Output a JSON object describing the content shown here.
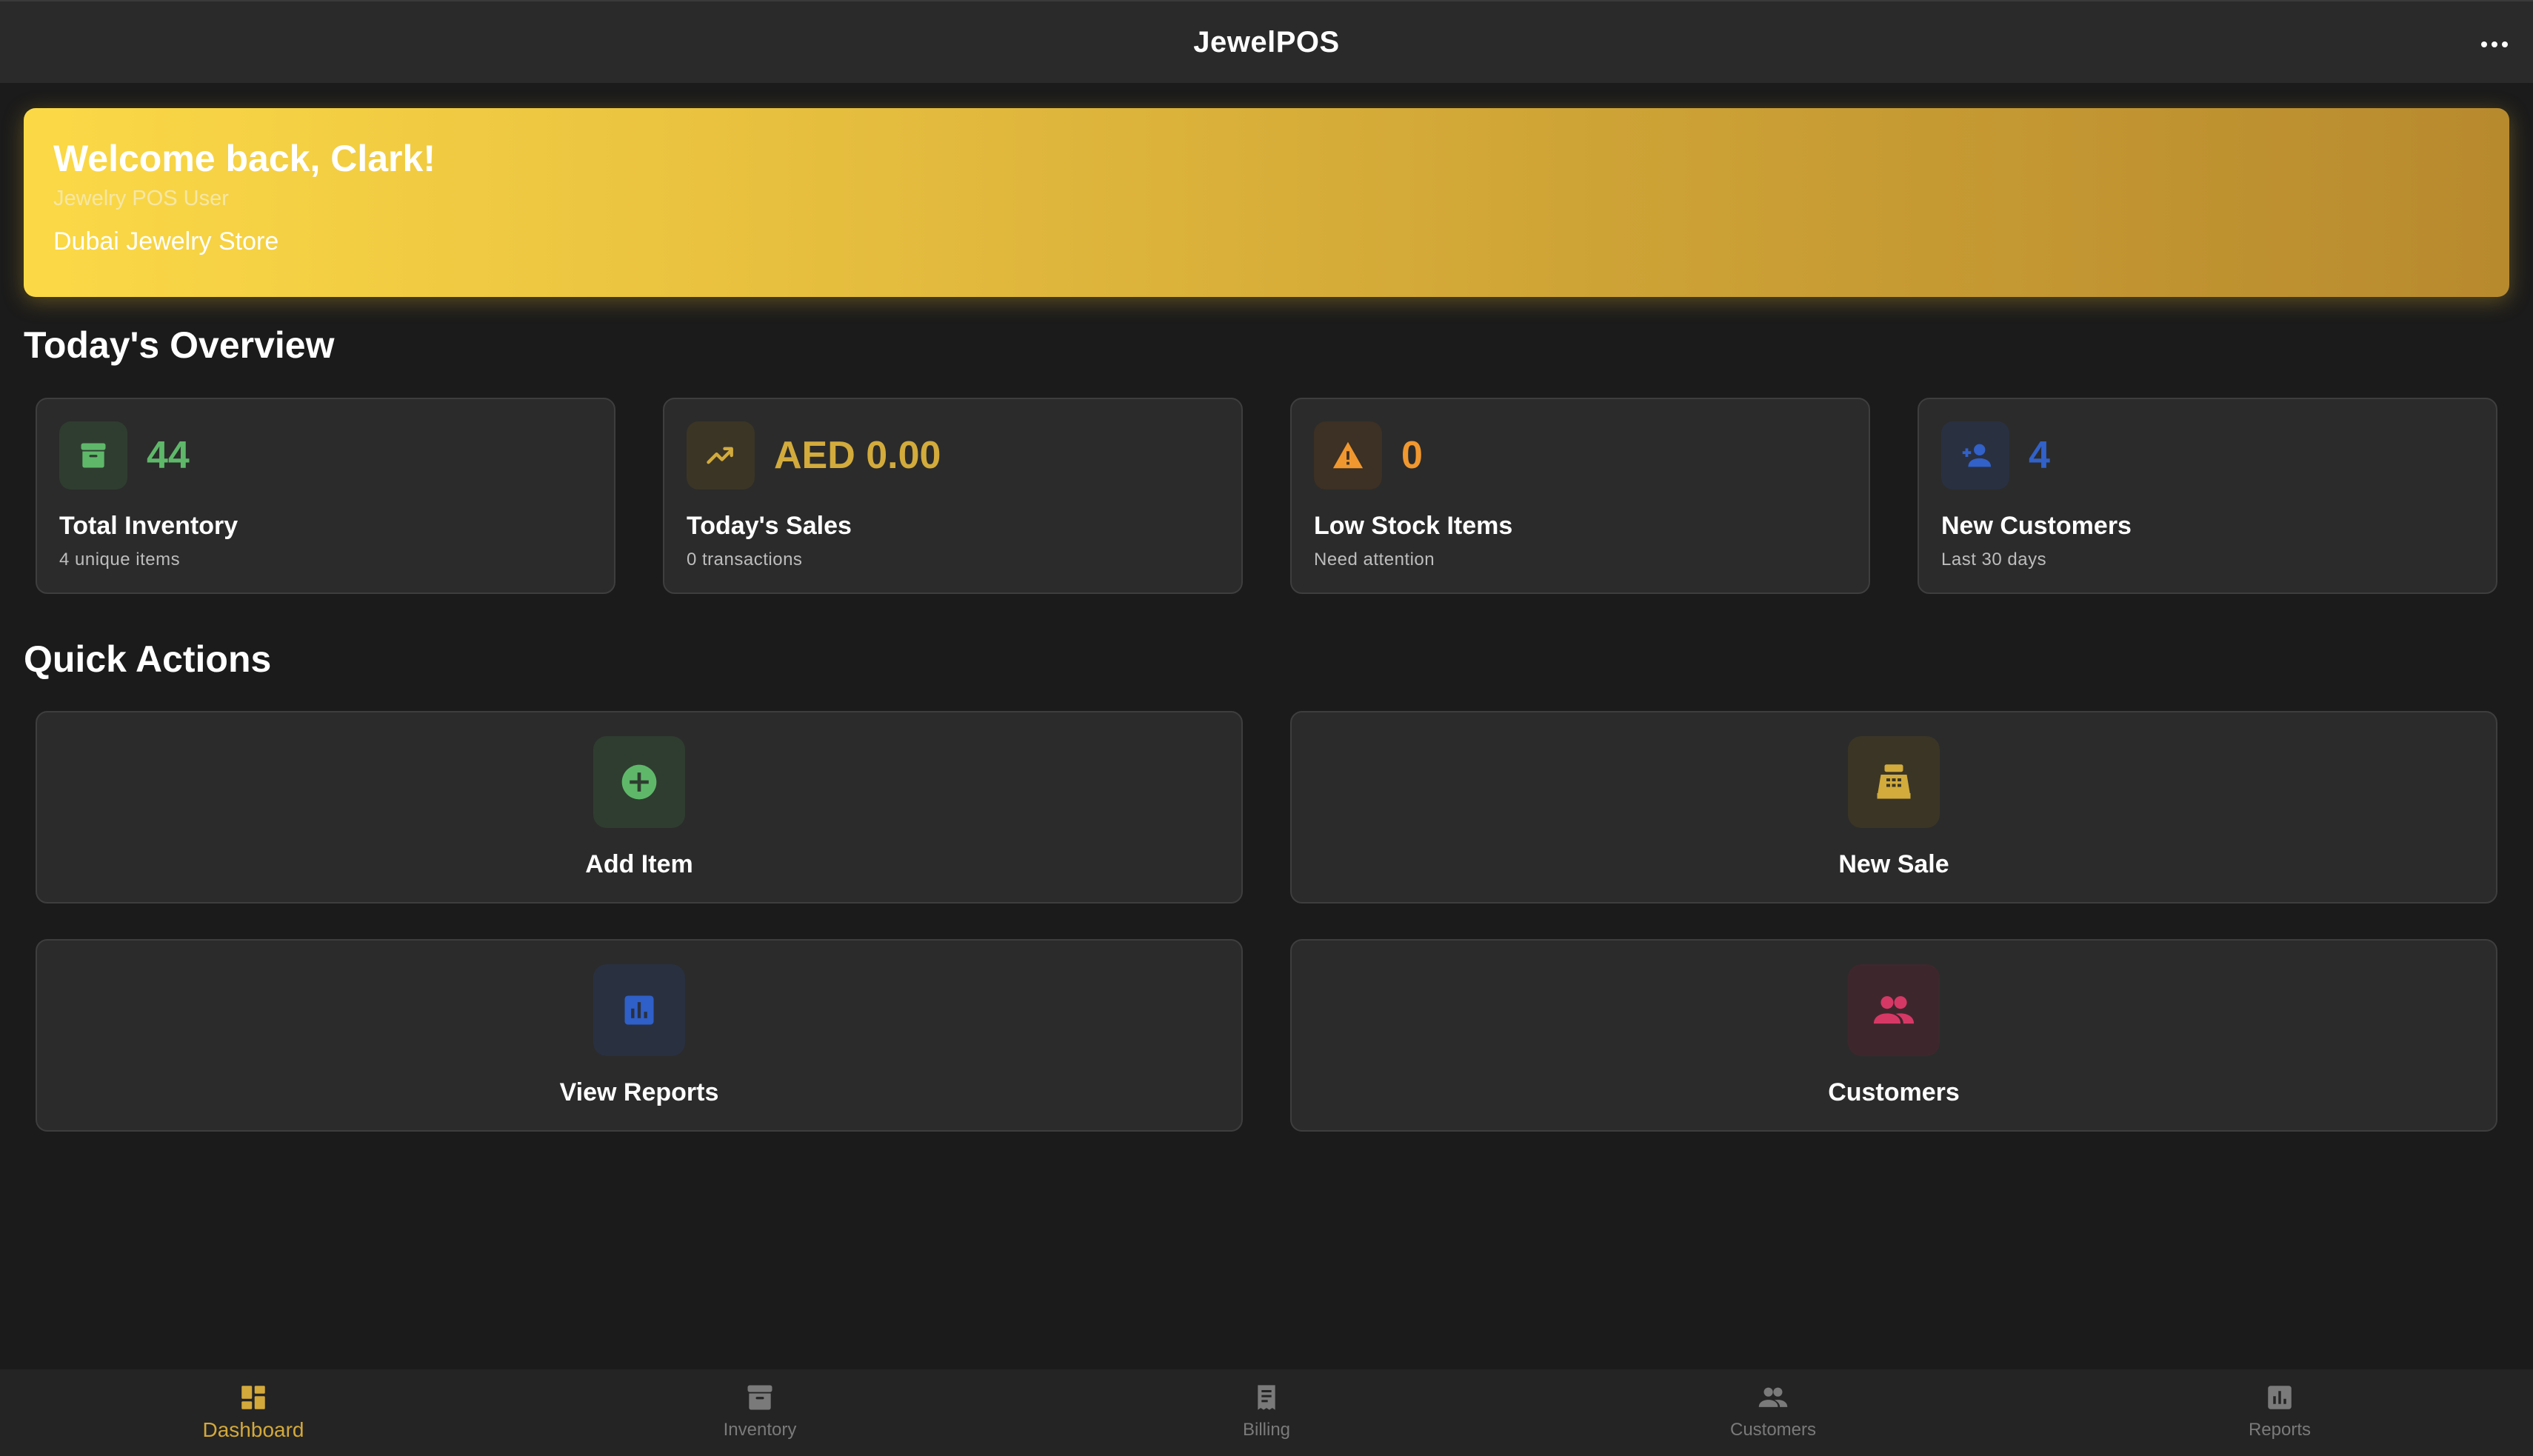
{
  "app": {
    "title": "JewelPOS",
    "more_icon": "more-horizontal-icon"
  },
  "banner": {
    "welcome": "Welcome back, Clark!",
    "role": "Jewelry POS User",
    "store": "Dubai Jewelry Store"
  },
  "overview": {
    "title": "Today's Overview",
    "cards": [
      {
        "icon": "archive-icon",
        "value": "44",
        "label": "Total Inventory",
        "sub": "4 unique items",
        "color": "#5fb86a",
        "bg": "#2f3d30"
      },
      {
        "icon": "trending-up-icon",
        "value": "AED 0.00",
        "label": "Today's Sales",
        "sub": "0 transactions",
        "color": "#d2ab3c",
        "bg": "#3b3526"
      },
      {
        "icon": "warning-icon",
        "value": "0",
        "label": "Low Stock Items",
        "sub": "Need attention",
        "color": "#f0982f",
        "bg": "#3d3024"
      },
      {
        "icon": "person-add-icon",
        "value": "4",
        "label": "New Customers",
        "sub": "Last 30 days",
        "color": "#3161c9",
        "bg": "#293040"
      }
    ]
  },
  "quick_actions": {
    "title": "Quick Actions",
    "items": [
      {
        "icon": "add-circle-icon",
        "label": "Add Item",
        "color": "#5fb86a",
        "bg": "#2f3d30"
      },
      {
        "icon": "cash-register-icon",
        "label": "New Sale",
        "color": "#d2ab3c",
        "bg": "#3b3526"
      },
      {
        "icon": "bar-chart-icon",
        "label": "View Reports",
        "color": "#2f5fc8",
        "bg": "#293040"
      },
      {
        "icon": "people-icon",
        "label": "Customers",
        "color": "#d63866",
        "bg": "#3d272d"
      }
    ]
  },
  "bottom_nav": {
    "active_color": "#d4a93b",
    "inactive_color": "#7a7a7a",
    "items": [
      {
        "icon": "dashboard-icon",
        "label": "Dashboard",
        "active": true
      },
      {
        "icon": "inventory-icon",
        "label": "Inventory",
        "active": false
      },
      {
        "icon": "receipt-icon",
        "label": "Billing",
        "active": false
      },
      {
        "icon": "people-icon",
        "label": "Customers",
        "active": false
      },
      {
        "icon": "bar-chart-icon",
        "label": "Reports",
        "active": false
      }
    ]
  }
}
